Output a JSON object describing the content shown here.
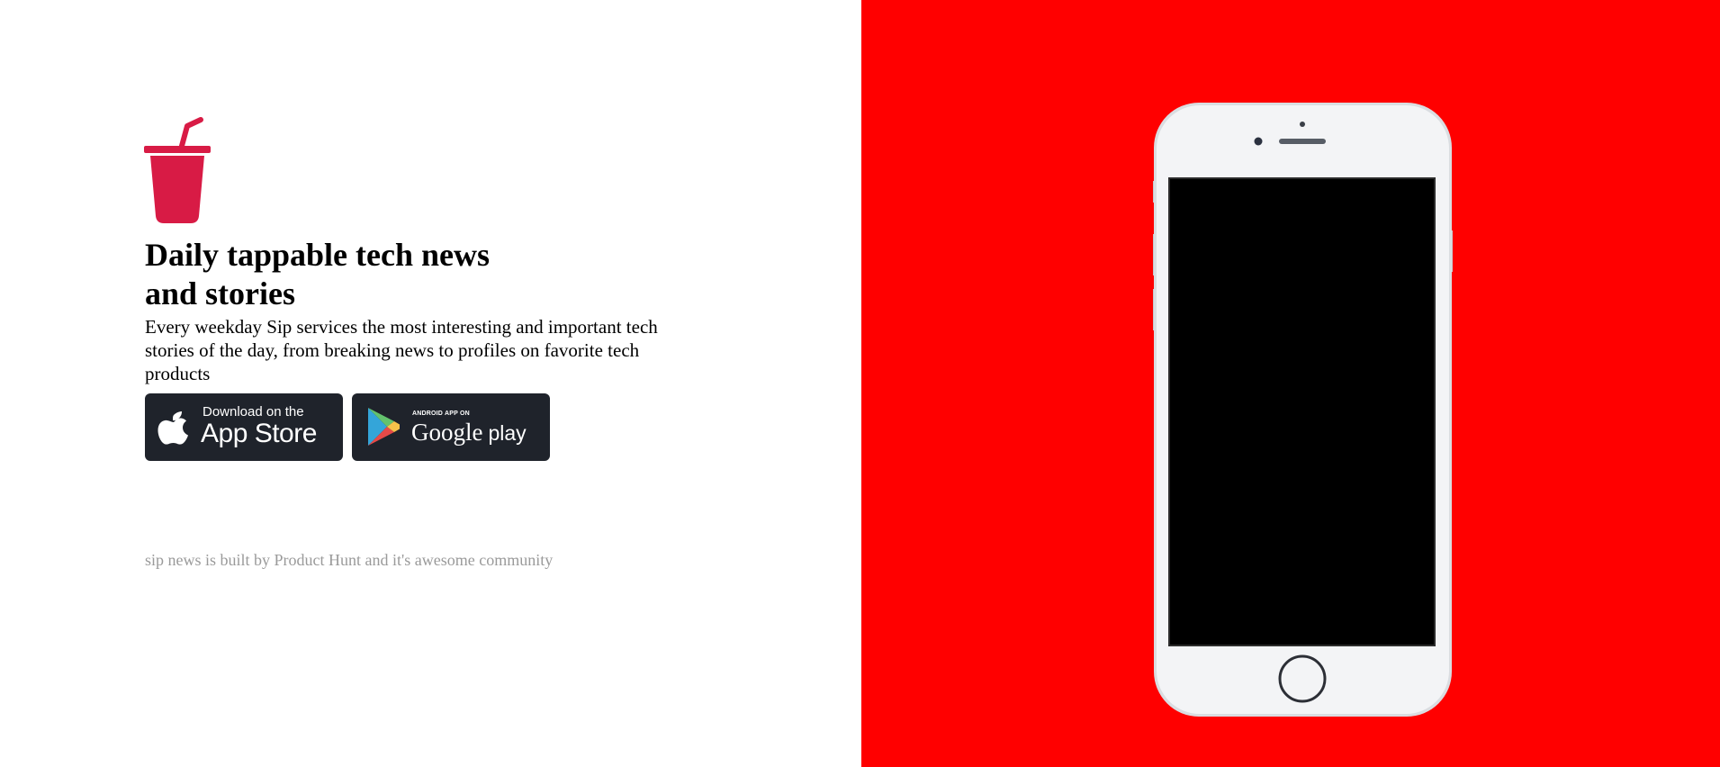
{
  "colors": {
    "accent": "#d81b45",
    "hero_background": "#ff0000",
    "button_background": "#1f232b",
    "footer_text": "#9a9a9a"
  },
  "logo": {
    "icon": "drink-cup-icon"
  },
  "hero": {
    "headline_line1": "Daily tappable tech news",
    "headline_line2": "and stories",
    "description": "Every weekday Sip services the most interesting and important tech stories of the day, from breaking news to profiles on favorite tech products"
  },
  "store_buttons": {
    "app_store": {
      "icon": "apple-icon",
      "small_text": "Download on the",
      "big_text": "App Store"
    },
    "google_play": {
      "icon": "google-play-icon",
      "small_text": "ANDROID APP ON",
      "brand_text": "Google",
      "big_text": "play"
    }
  },
  "footer": {
    "note": "sip news is built by Product Hunt and it's awesome community"
  },
  "device": {
    "icon": "iphone-mockup"
  }
}
